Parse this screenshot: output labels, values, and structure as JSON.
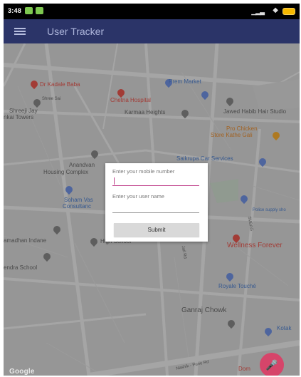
{
  "status_bar": {
    "time": "3:48"
  },
  "app_bar": {
    "title": "User Tracker"
  },
  "map": {
    "places": [
      {
        "name": "Dr Kadale Baba",
        "style": "red"
      },
      {
        "name": "Prem Market",
        "style": "blue"
      },
      {
        "name": "Shree Sai",
        "style": ""
      },
      {
        "name": "Chetna Hospital",
        "style": "red"
      },
      {
        "name": "Shreeji Jay",
        "style": ""
      },
      {
        "name": "nkai Towers",
        "style": ""
      },
      {
        "name": "Karmaa Heights",
        "style": ""
      },
      {
        "name": "Jawed Habib Hair Studio",
        "style": ""
      },
      {
        "name": "Pro Chicken",
        "style": "orange"
      },
      {
        "name": "Store Kathe Gali",
        "style": "orange"
      },
      {
        "name": "Saikrupa Car Services",
        "style": "blue"
      },
      {
        "name": "Anandvan",
        "style": ""
      },
      {
        "name": "Housing Complex",
        "style": ""
      },
      {
        "name": "Soham Vas",
        "style": "blue"
      },
      {
        "name": "Consultanc",
        "style": "blue"
      },
      {
        "name": "Police supply sho",
        "style": "blue"
      },
      {
        "name": "amadhan Indane",
        "style": ""
      },
      {
        "name": "High School",
        "style": ""
      },
      {
        "name": "Wellness Forever",
        "style": "red"
      },
      {
        "name": "endra School",
        "style": ""
      },
      {
        "name": "Royale Touché",
        "style": "blue"
      },
      {
        "name": "Ganraj Chowk",
        "style": ""
      },
      {
        "name": "Kotak",
        "style": "blue"
      },
      {
        "name": "Dom",
        "style": "red"
      },
      {
        "name": "Nashik - Pune Rd",
        "style": ""
      },
      {
        "name": "SVBAG",
        "style": ""
      },
      {
        "name": "Jail Rd",
        "style": ""
      }
    ],
    "attribution": "Google"
  },
  "dialog": {
    "mobile_label": "Enter your mobile number",
    "mobile_value": "",
    "username_label": "Enter your user name",
    "username_value": "",
    "submit_label": "Submit"
  },
  "fab": {
    "icon": "mic-icon"
  },
  "colors": {
    "app_bar": "#2b3468",
    "accent": "#c0408a",
    "fab": "#d6456a"
  }
}
